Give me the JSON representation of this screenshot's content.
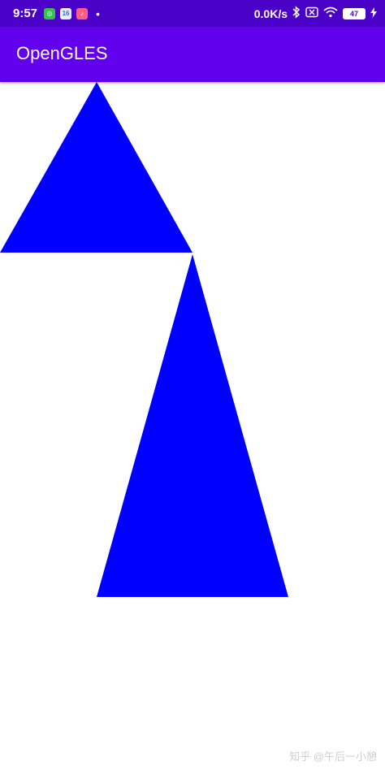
{
  "status_bar": {
    "time": "9:57",
    "notif_badge": "16",
    "dot": "•",
    "network_speed": "0.0K/s",
    "battery_level": "47"
  },
  "app_bar": {
    "title": "OpenGLES"
  },
  "scene": {
    "triangle_color": "#0000ff",
    "background_color": "#ffffff"
  },
  "watermark": "知乎 @午后一小憩"
}
